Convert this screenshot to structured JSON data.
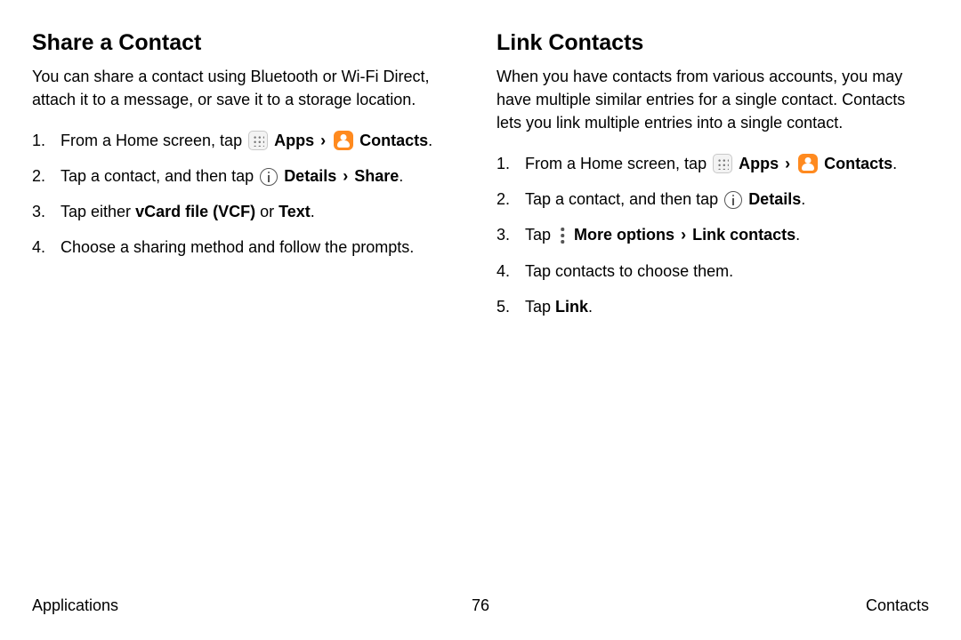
{
  "left": {
    "heading": "Share a Contact",
    "intro": "You can share a contact using Bluetooth or Wi‑Fi Direct, attach it to a message, or save it to a storage location.",
    "step1_a": "From a Home screen, tap ",
    "apps": "Apps",
    "contacts": "Contacts",
    "step2_a": "Tap a contact, and then tap ",
    "details": "Details",
    "share": "Share",
    "step3_a": "Tap either ",
    "step3_b": "vCard file (VCF)",
    "step3_c": " or ",
    "step3_d": "Text",
    "step4": "Choose a sharing method and follow the prompts."
  },
  "right": {
    "heading": "Link Contacts",
    "intro": "When you have contacts from various accounts, you may have multiple similar entries for a single contact. Contacts lets you link multiple entries into a single contact.",
    "step1_a": "From a Home screen, tap ",
    "apps": "Apps",
    "contacts": "Contacts",
    "step2_a": "Tap a contact, and then tap ",
    "details": "Details",
    "step3_a": "Tap ",
    "moreoptions": "More options",
    "linkcontacts": "Link contacts",
    "step4": "Tap contacts to choose them.",
    "step5_a": "Tap ",
    "step5_b": "Link"
  },
  "footer": {
    "left": "Applications",
    "center": "76",
    "right": "Contacts"
  },
  "glyph": {
    "chevron": "›",
    "period": "."
  }
}
